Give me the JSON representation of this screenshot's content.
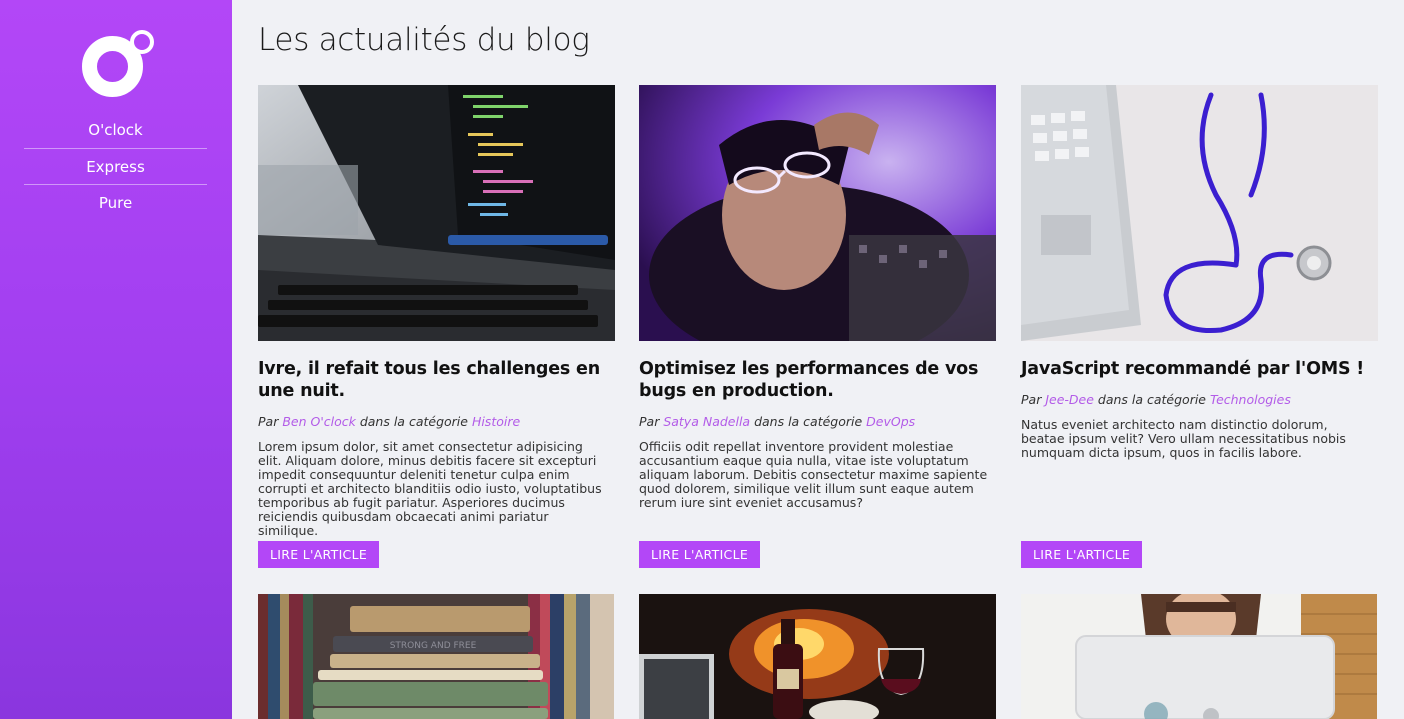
{
  "sidebar": {
    "nav_items": [
      "O'clock",
      "Express",
      "Pure"
    ]
  },
  "main": {
    "title": "Les actualités du blog"
  },
  "articles": [
    {
      "title": "Ivre, il refait tous les challenges en une nuit.",
      "by_prefix": "Par ",
      "author": "Ben O'clock",
      "cat_prefix": " dans la catégorie ",
      "category": "Histoire",
      "excerpt": "Lorem ipsum dolor, sit amet consectetur adipisicing elit. Aliquam dolore, minus debitis facere sit excepturi impedit consequuntur deleniti tenetur culpa enim corrupti et architecto blanditiis odio iusto, voluptatibus temporibus ab fugit pariatur. Asperiores ducimus reiciendis quibusdam obcaecati animi pariatur similique.",
      "button": "LIRE L'ARTICLE"
    },
    {
      "title": "Optimisez les performances de vos bugs en production.",
      "by_prefix": "Par ",
      "author": "Satya Nadella",
      "cat_prefix": " dans la catégorie ",
      "category": "DevOps",
      "excerpt": "Officiis odit repellat inventore provident molestiae accusantium eaque quia nulla, vitae iste voluptatum aliquam laborum. Debitis consectetur maxime sapiente quod dolorem, similique velit illum sunt eaque autem rerum iure sint eveniet accusamus?",
      "button": "LIRE L'ARTICLE"
    },
    {
      "title": "JavaScript recommandé par l'OMS !",
      "by_prefix": "Par ",
      "author": "Jee-Dee",
      "cat_prefix": " dans la catégorie ",
      "category": "Technologies",
      "excerpt": "Natus eveniet architecto nam distinctio dolorum, beatae ipsum velit? Vero ullam necessitatibus nobis numquam dicta ipsum, quos in facilis labore.",
      "button": "LIRE L'ARTICLE"
    }
  ],
  "images": {
    "laptop_code": "laptop-code-photo",
    "person_glasses": "person-glasses-photo",
    "stethoscope": "stethoscope-laptop-photo",
    "books": "books-stack-photo",
    "wine_fire": "wine-fireplace-photo",
    "woman_laptop": "woman-laptop-photo",
    "lettering": {
      "book_spine": "STRONG AND FREE"
    }
  },
  "colors": {
    "accent": "#b347f7",
    "link": "#b35ce8",
    "background": "#f0f1f5"
  }
}
